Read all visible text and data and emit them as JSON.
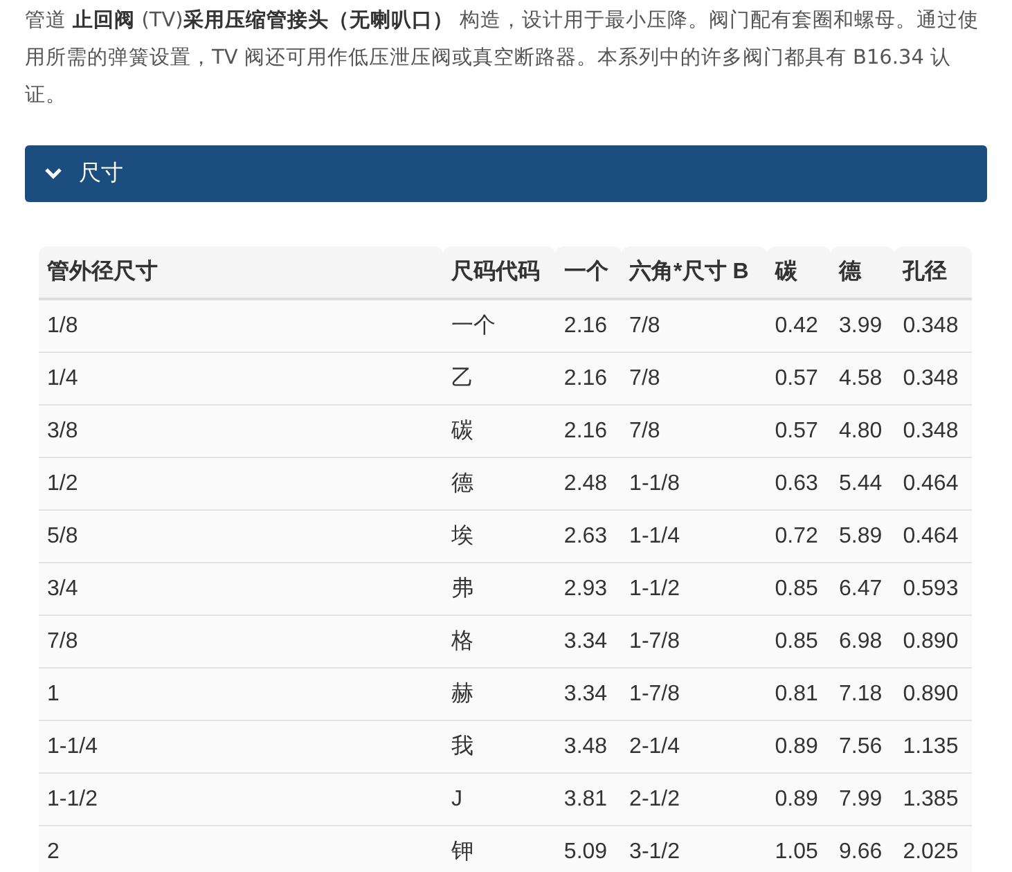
{
  "intro": "管道 **止回阀** (TV)**采用压缩管接头（无喇叭口）** 构造，设计用于最小压降。阀门配有套圈和螺母。通过使用所需的弹簧设置，TV 阀还可用作低压泄压阀或真空断路器。本系列中的许多阀门都具有 B16.34 认证。",
  "section": {
    "title": "尺寸",
    "expanded": true
  },
  "table": {
    "columns": [
      "管外径尺寸",
      "尺码代码",
      "一个",
      "六角*尺寸 B",
      "碳",
      "德",
      "孔径"
    ],
    "rows": [
      [
        "1/8",
        "一个",
        "2.16",
        "7/8",
        "0.42",
        "3.99",
        "0.348"
      ],
      [
        "1/4",
        "乙",
        "2.16",
        "7/8",
        "0.57",
        "4.58",
        "0.348"
      ],
      [
        "3/8",
        "碳",
        "2.16",
        "7/8",
        "0.57",
        "4.80",
        "0.348"
      ],
      [
        "1/2",
        "德",
        "2.48",
        "1-1/8",
        "0.63",
        "5.44",
        "0.464"
      ],
      [
        "5/8",
        "埃",
        "2.63",
        "1-1/4",
        "0.72",
        "5.89",
        "0.464"
      ],
      [
        "3/4",
        "弗",
        "2.93",
        "1-1/2",
        "0.85",
        "6.47",
        "0.593"
      ],
      [
        "7/8",
        "格",
        "3.34",
        "1-7/8",
        "0.85",
        "6.98",
        "0.890"
      ],
      [
        "1",
        "赫",
        "3.34",
        "1-7/8",
        "0.81",
        "7.18",
        "0.890"
      ],
      [
        "1-1/4",
        "我",
        "3.48",
        "2-1/4",
        "0.89",
        "7.56",
        "1.135"
      ],
      [
        "1-1/2",
        "J",
        "3.81",
        "2-1/2",
        "0.89",
        "7.99",
        "1.385"
      ],
      [
        "2",
        "钾",
        "5.09",
        "3-1/2",
        "1.05",
        "9.66",
        "2.025"
      ]
    ]
  }
}
